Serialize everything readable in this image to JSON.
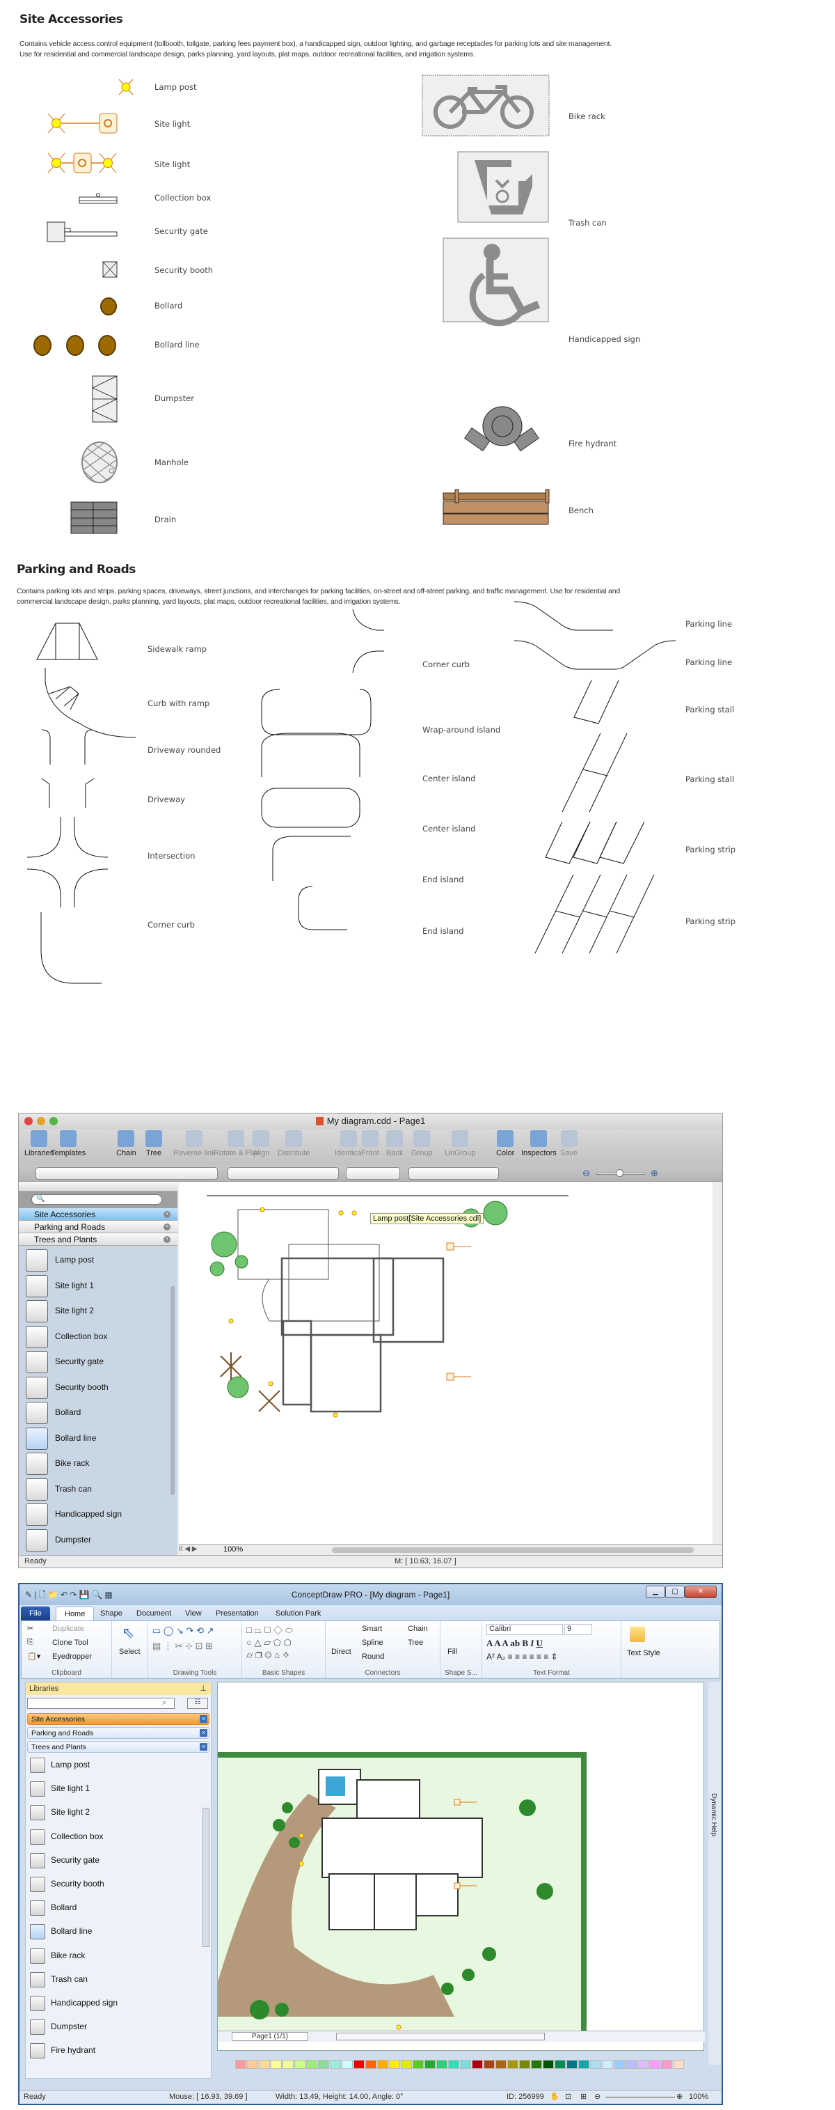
{
  "site_accessories": {
    "title": "Site Accessories",
    "description_line1": "Contains vehicle access control equipment (tollbooth, tollgate, parking fees payment box), a handicapped sign, outdoor lighting, and garbage receptacles for parking lots and site management.",
    "description_line2": "Use for residential and commercial landscape design, parks planning, yard layouts, plat maps, outdoor recreational facilities, and irrigation systems.",
    "left_items": [
      "Lamp post",
      "Site light",
      "Site light",
      "Collection box",
      "Security gate",
      "Security booth",
      "Bollard",
      "Bollard line",
      "Dumpster",
      "Manhole",
      "Drain"
    ],
    "right_items": [
      "Bike rack",
      "Trash can",
      "Handicapped sign",
      "Fire hydrant",
      "Bench"
    ]
  },
  "parking_roads": {
    "title": "Parking and Roads",
    "description_line1": "Contains parking lots and strips, parking spaces, driveways, street junctions, and interchanges for parking facilities, on-street and off-street parking, and traffic management. Use for residential and",
    "description_line2": "commercial landscape design, parks planning, yard layouts, plat maps, outdoor recreational facilities, and irrigation systems.",
    "col1": [
      "Sidewalk ramp",
      "Curb with ramp",
      "Driveway rounded",
      "Driveway",
      "Intersection",
      "Corner curb"
    ],
    "col2": [
      "Corner curb",
      "Wrap-around island",
      "Center island",
      "Center island",
      "End island",
      "End island"
    ],
    "col3": [
      "Parking line",
      "Parking line",
      "Parking stall",
      "Parking stall",
      "Parking strip",
      "Parking strip"
    ]
  },
  "mac_app": {
    "title": "My diagram.cdd - Page1",
    "toolbar": [
      {
        "label": "Libraries",
        "enabled": true
      },
      {
        "label": "Templates",
        "enabled": true
      },
      {
        "label": "Chain",
        "enabled": true
      },
      {
        "label": "Tree",
        "enabled": true
      },
      {
        "label": "Reverse link",
        "enabled": false
      },
      {
        "label": "Rotate & Flip",
        "enabled": false
      },
      {
        "label": "Align",
        "enabled": false
      },
      {
        "label": "Distribute",
        "enabled": false
      },
      {
        "label": "Identical",
        "enabled": false
      },
      {
        "label": "Front",
        "enabled": false
      },
      {
        "label": "Back",
        "enabled": false
      },
      {
        "label": "Group",
        "enabled": false
      },
      {
        "label": "UnGroup",
        "enabled": false
      },
      {
        "label": "Color",
        "enabled": true
      },
      {
        "label": "Inspectors",
        "enabled": true
      },
      {
        "label": "Save",
        "enabled": false
      }
    ],
    "libraries": [
      "Site Accessories",
      "Parking and Roads",
      "Trees and Plants"
    ],
    "library_items": [
      "Lamp post",
      "Site light 1",
      "Site light 2",
      "Collection box",
      "Security gate",
      "Security booth",
      "Bollard",
      "Bollard line",
      "Bike rack",
      "Trash can",
      "Handicapped sign",
      "Dumpster"
    ],
    "selected_item": "Bollard line",
    "tooltip": "Lamp post[Site Accessories.cdl]",
    "zoom": "100%",
    "status": "Ready",
    "mouse": "M: [ 10.63, 16.07 ]"
  },
  "win_app": {
    "title": "ConceptDraw PRO - [My diagram - Page1]",
    "tabs": [
      "File",
      "Home",
      "Shape",
      "Document",
      "View",
      "Presentation",
      "Solution Park"
    ],
    "active_tab": "Home",
    "clipboard": {
      "duplicate": "Duplicate",
      "clone": "Clone Tool",
      "eyedropper": "Eyedropper",
      "label": "Clipboard"
    },
    "select_label": "Select",
    "drawing_tools_label": "Drawing Tools",
    "basic_shapes_label": "Basic Shapes",
    "connectors": {
      "direct": "Direct",
      "smart": "Smart",
      "spline": "Spline",
      "round": "Round",
      "chain": "Chain",
      "tree": "Tree",
      "label": "Connectors"
    },
    "shape_style": {
      "fill": "Fill",
      "label": "Shape S..."
    },
    "text_format": {
      "font": "Calibri",
      "size": "9",
      "label": "Text Format"
    },
    "text_style": "Text Style",
    "libraries_title": "Libraries",
    "libraries": [
      "Site Accessories",
      "Parking and Roads",
      "Trees and Plants"
    ],
    "library_items": [
      "Lamp post",
      "Site light 1",
      "Site light 2",
      "Collection box",
      "Security gate",
      "Security booth",
      "Bollard",
      "Bollard line",
      "Bike rack",
      "Trash can",
      "Handicapped sign",
      "Dumpster",
      "Fire hydrant"
    ],
    "selected_item": "Bollard line",
    "page_selector": "Page1 (1/1)",
    "dynamic_help": "Dynamic Help",
    "status": {
      "ready": "Ready",
      "mouse": "Mouse: [ 16.93, 39.69 ]",
      "size": "Width: 13.49,  Height: 14.00,  Angle: 0°",
      "id": "ID: 256999",
      "zoom": "100%"
    },
    "palette": [
      "#f99",
      "#fc9",
      "#fd9",
      "#ff9",
      "#ef9",
      "#cf8",
      "#9e7",
      "#8d9",
      "#9ed",
      "#cff",
      "#e00",
      "#f60",
      "#fa0",
      "#fe0",
      "#de0",
      "#5c2",
      "#2a3",
      "#3c7",
      "#3db",
      "#7dd",
      "#a01",
      "#a41",
      "#a61",
      "#a90",
      "#780",
      "#270",
      "#050",
      "#085",
      "#078",
      "#0aa",
      "#ade",
      "#cef",
      "#9cf",
      "#bbf",
      "#dbf",
      "#f9f",
      "#f9c",
      "#fdc"
    ]
  }
}
